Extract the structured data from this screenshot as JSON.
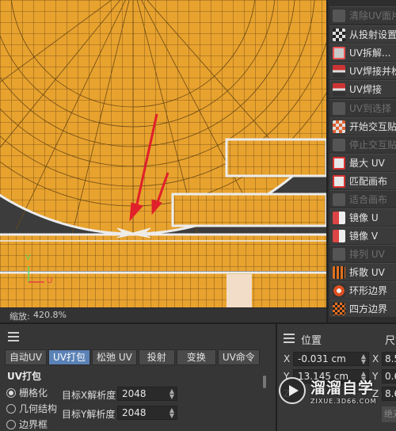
{
  "viewport": {
    "zoom_label": "缩放:",
    "zoom_value": "420.8%",
    "axis_v": "V",
    "axis_u": "U",
    "colors": {
      "background": "#3c3c3c",
      "uv_fill": "#e8a22e",
      "uv_grid": "#6b4a16",
      "uv_outline": "#ececec",
      "arrow": "#e0202a",
      "gizmo_v": "#5fd45f",
      "gizmo_u": "#e04040"
    }
  },
  "commands": [
    {
      "label": "清除UV面片",
      "icon": "uv-clear-icon",
      "disabled": true
    },
    {
      "label": "从投射设置U",
      "icon": "checker-icon",
      "disabled": false
    },
    {
      "label": "UV拆解...",
      "icon": "uv-cube-icon",
      "disabled": false
    },
    {
      "label": "UV焊接并松",
      "icon": "weld-relax-icon",
      "disabled": false
    },
    {
      "label": "UV焊接",
      "icon": "weld-icon",
      "disabled": false
    },
    {
      "label": "UV到选择",
      "icon": "uv-to-selection-icon",
      "disabled": true
    },
    {
      "label": "开始交互贴图",
      "icon": "paint-start-icon",
      "disabled": false
    },
    {
      "label": "停止交互贴图",
      "icon": "paint-stop-icon",
      "disabled": true
    },
    {
      "label": "最大 UV",
      "icon": "max-uv-icon",
      "disabled": false
    },
    {
      "label": "匹配画布",
      "icon": "match-canvas-icon",
      "disabled": false
    },
    {
      "label": "适合画布",
      "icon": "fit-canvas-icon",
      "disabled": true
    },
    {
      "label": "镜像 U",
      "icon": "mirror-u-icon",
      "disabled": false
    },
    {
      "label": "镜像 V",
      "icon": "mirror-v-icon",
      "disabled": false
    },
    {
      "label": "排列 UV",
      "icon": "arrange-uv-icon",
      "disabled": true
    },
    {
      "label": "拆散 UV",
      "icon": "scatter-uv-icon",
      "disabled": false
    },
    {
      "label": "环形边界",
      "icon": "ring-border-icon",
      "disabled": false
    },
    {
      "label": "四方边界",
      "icon": "quad-border-icon",
      "disabled": false
    }
  ],
  "tabs": [
    {
      "label": "自动UV",
      "active": false
    },
    {
      "label": "UV打包",
      "active": true
    },
    {
      "label": "松弛 UV",
      "active": false
    },
    {
      "label": "投射",
      "active": false
    },
    {
      "label": "变换",
      "active": false
    },
    {
      "label": "UV命令",
      "active": false
    }
  ],
  "pack": {
    "title": "UV打包",
    "options": [
      {
        "label": "栅格化",
        "checked": true
      },
      {
        "label": "几何结构",
        "checked": false
      },
      {
        "label": "边界框",
        "checked": false
      }
    ],
    "target_x_label": "目标X解析度",
    "target_x_value": "2048",
    "target_y_label": "目标Y解析度",
    "target_y_value": "2048"
  },
  "coord": {
    "title": "位置",
    "title2": "尺寸",
    "x_label": "X",
    "x_value": "-0.031 cm",
    "y_label": "Y",
    "y_value": "13.145 cm",
    "z_label": "Z",
    "size_x_label": "X",
    "size_x_value": "8.5",
    "size_y_label": "Y",
    "size_y_value": "0.6",
    "size_z_label": "Z",
    "size_z_value": "8.6",
    "apply_label": "绝对"
  },
  "watermark": {
    "main": "溜溜自学",
    "sub": "ZIXUE.3D66.COM"
  }
}
